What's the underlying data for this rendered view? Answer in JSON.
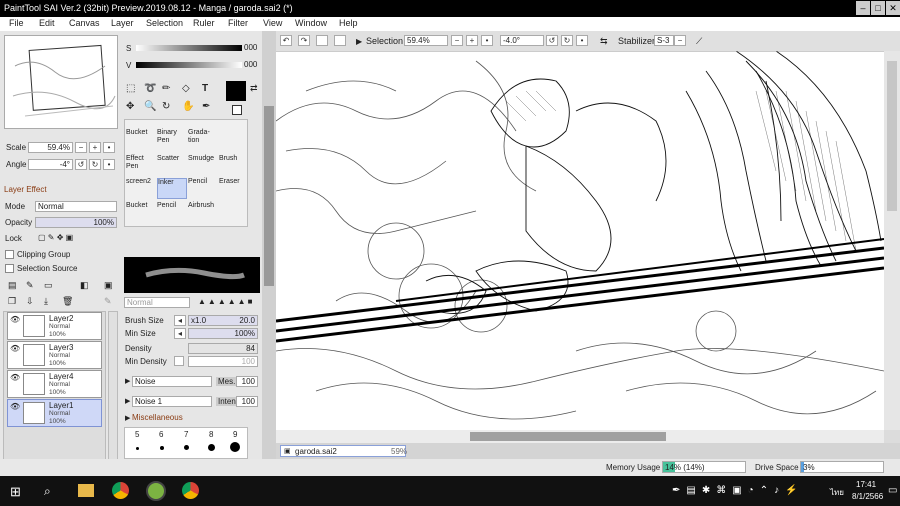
{
  "window": {
    "title": "PaintTool SAI Ver.2 (32bit) Preview.2019.08.12 - Manga / garoda.sai2 (*)",
    "min": "–",
    "max": "□",
    "close": "✕"
  },
  "menu": [
    "File",
    "Edit",
    "Canvas",
    "Layer",
    "Selection",
    "Ruler",
    "Filter",
    "View",
    "Window",
    "Help"
  ],
  "navigator": {
    "scale_label": "Scale",
    "scale_value": "59.4%",
    "angle_label": "Angle",
    "angle_value": "-4°"
  },
  "layer_panel": {
    "header": "Layer Effect",
    "mode_label": "Mode",
    "mode_value": "Normal",
    "opacity_label": "Opacity",
    "opacity_value": "100%",
    "lock_label": "Lock",
    "clipping_group": "Clipping Group",
    "selection_source": "Selection Source",
    "layers": [
      {
        "name": "Layer2",
        "mode": "Normal",
        "opacity": "100%"
      },
      {
        "name": "Layer3",
        "mode": "Normal",
        "opacity": "100%"
      },
      {
        "name": "Layer4",
        "mode": "Normal",
        "opacity": "100%"
      },
      {
        "name": "Layer1",
        "mode": "Normal",
        "opacity": "100%"
      }
    ]
  },
  "color": {
    "s_label": "S",
    "s_value": "000",
    "v_label": "V",
    "v_value": "000"
  },
  "tools": [
    [
      "Bucket",
      "Binary Pen",
      "Grada-tion"
    ],
    [
      "Effect Pen",
      "Scatter",
      "Smudge",
      "Brush"
    ],
    [
      "screen2",
      "Inker",
      "Pencil",
      "Eraser"
    ],
    [
      "Bucket",
      "Pencil",
      "Airbrush"
    ]
  ],
  "brush": {
    "blend": "Normal",
    "size_label": "Brush Size",
    "size_mult": "x1.0",
    "size_value": "20.0",
    "min_size_label": "Min Size",
    "min_size_value": "100%",
    "density_label": "Density",
    "density_value": "84",
    "min_density_label": "Min Density",
    "min_density_value": "100",
    "noise1": "Noise",
    "noise1_param": "Mes.",
    "noise1_value": "100",
    "noise2": "Noise 1",
    "noise2_param": "Intens",
    "noise2_value": "100",
    "misc_label": "Miscellaneous",
    "size_numbers": [
      "5",
      "6",
      "7",
      "8",
      "9"
    ]
  },
  "canvas_toolbar": {
    "selection_label": "Selection",
    "zoom": "59.4%",
    "angle": "-4.0°",
    "stabilizer_label": "Stabilizer",
    "stabilizer_value": "S-3"
  },
  "tab": {
    "name": "garoda.sai2",
    "zoom": "59%"
  },
  "status": {
    "memory_label": "Memory Usage",
    "memory_value": "14% (14%)",
    "drive_label": "Drive Space",
    "drive_value": "3%"
  },
  "taskbar": {
    "time": "17:41",
    "date": "8/1/2566",
    "lang": "ไทย"
  }
}
